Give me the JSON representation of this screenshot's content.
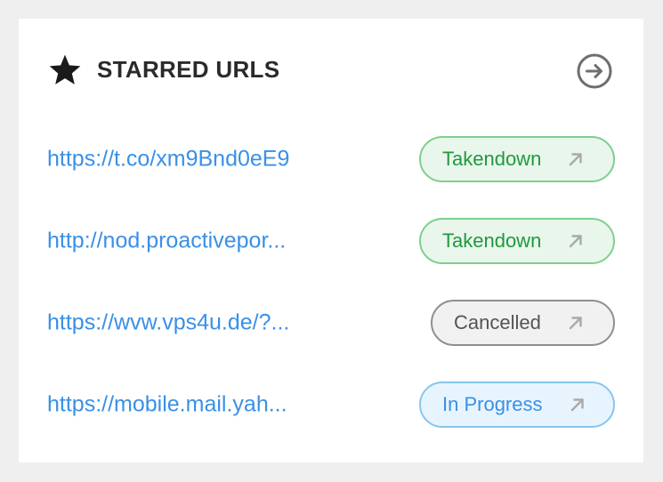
{
  "widget": {
    "title": "STARRED URLS",
    "star_icon": "star-icon",
    "open_icon": "arrow-right-circle-icon"
  },
  "rows": [
    {
      "url": "https://t.co/xm9Bnd0eE9",
      "status": "Takendown",
      "status_color": "#1f9a3a",
      "action_icon": "arrow-up-right-icon"
    },
    {
      "url": "http://nod.proactivepor...",
      "status": "Takendown",
      "status_color": "#1f9a3a",
      "action_icon": "arrow-up-right-icon"
    },
    {
      "url": "https://wvw.vps4u.de/?...",
      "status": "Cancelled",
      "status_color": "#555555",
      "action_icon": "arrow-up-right-icon"
    },
    {
      "url": "https://mobile.mail.yah...",
      "status": "In Progress",
      "status_color": "#3a90e6",
      "action_icon": "arrow-up-right-icon"
    }
  ],
  "colors": {
    "link": "#3a90e6",
    "title": "#2a2a2a",
    "background": "#efefef",
    "card": "#ffffff"
  }
}
